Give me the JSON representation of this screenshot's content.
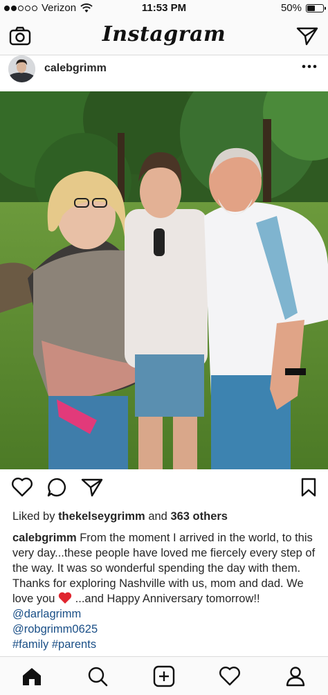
{
  "status_bar": {
    "carrier": "Verizon",
    "time": "11:53 PM",
    "battery": "50%",
    "battery_level": 0.5,
    "signal_bars": 2
  },
  "nav": {
    "title": "Instagram",
    "left_icon": "camera-icon",
    "right_icon": "direct-message-icon"
  },
  "post": {
    "username": "calebgrimm",
    "more_icon": "more-options-icon",
    "likes": {
      "prefix": "Liked by",
      "liked_user": "thekelseygrimm",
      "connector": "and",
      "others": "363 others"
    },
    "caption": {
      "username": "calebgrimm",
      "text_part1": "From the moment I arrived in the world, to this very day...these people have loved me fiercely every step of the way. It was so wonderful spending the day with them. Thanks for exploring Nashville with us, mom and dad. We love you",
      "text_part2": "...and Happy Anniversary tomorrow!!",
      "mention1": "@darlagrimm",
      "mention2": "@robgrimm0625",
      "hashtag1": "#family",
      "hashtag2": "#parents"
    },
    "actions": [
      "like-icon",
      "comment-icon",
      "share-icon",
      "save-icon"
    ]
  },
  "tabbar": {
    "tabs": [
      "home-icon",
      "search-icon",
      "add-post-icon",
      "activity-heart-icon",
      "profile-icon"
    ]
  },
  "colors": {
    "link": "#1a4f87",
    "text": "#262626",
    "divider": "#dbdbdb",
    "heart_emoji": "#e0252f"
  }
}
